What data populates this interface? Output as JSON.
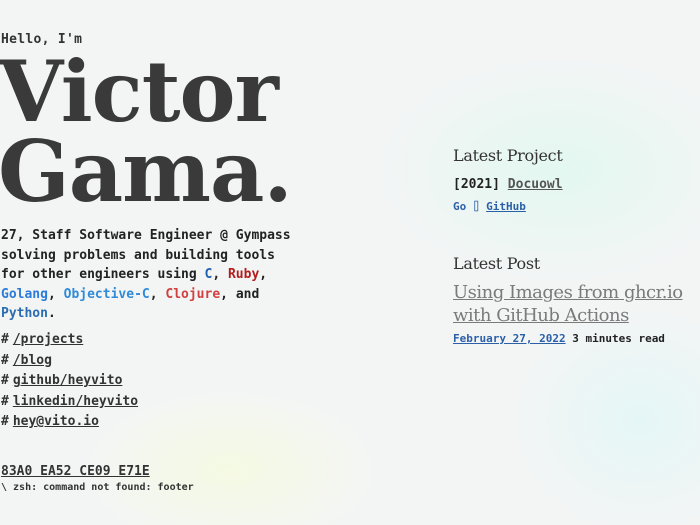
{
  "hero": {
    "greeting": "Hello, I'm",
    "name_line1": "Victor",
    "name_line2": "Gama."
  },
  "bio": {
    "intro": "27, Staff Software Engineer @ Gympass",
    "line2": "solving problems and building tools for other engineers using",
    "lang_c": "C",
    "sep1": ",",
    "lang_ruby": "Ruby",
    "sep2": ",",
    "lang_go": "Golang",
    "sep3": ",",
    "lang_objc": "Objective-C",
    "sep4": ",",
    "lang_clojure": "Clojure",
    "sep5": ", and",
    "lang_python": "Python",
    "end": "."
  },
  "links": [
    {
      "hash": "#",
      "label": "/projects"
    },
    {
      "hash": "#",
      "label": "/blog"
    },
    {
      "hash": "#",
      "label": "github/heyvito"
    },
    {
      "hash": "#",
      "label": "linkedin/heyvito"
    },
    {
      "hash": "#",
      "label": "hey@vito.io"
    }
  ],
  "footer": {
    "fingerprint": "83A0 EA52 CE09 E71E",
    "zsh": "\\ zsh: command not found: footer"
  },
  "latest_project": {
    "heading": "Latest Project",
    "year": "[2021]",
    "name": "Docuowl",
    "language": "Go",
    "separator": "⌷",
    "source": "GitHub"
  },
  "latest_post": {
    "heading": "Latest Post",
    "title": "Using Images from ghcr.io with GitHub Actions",
    "date": "February 27, 2022",
    "read_time": "3 minutes read"
  },
  "colors": {
    "background": "#f3f5f5",
    "ruby": "#b41c1c",
    "go": "#2b7bd8",
    "clojure": "#d04040",
    "python": "#2b6cb0",
    "link_blue": "#2b5fa8"
  }
}
